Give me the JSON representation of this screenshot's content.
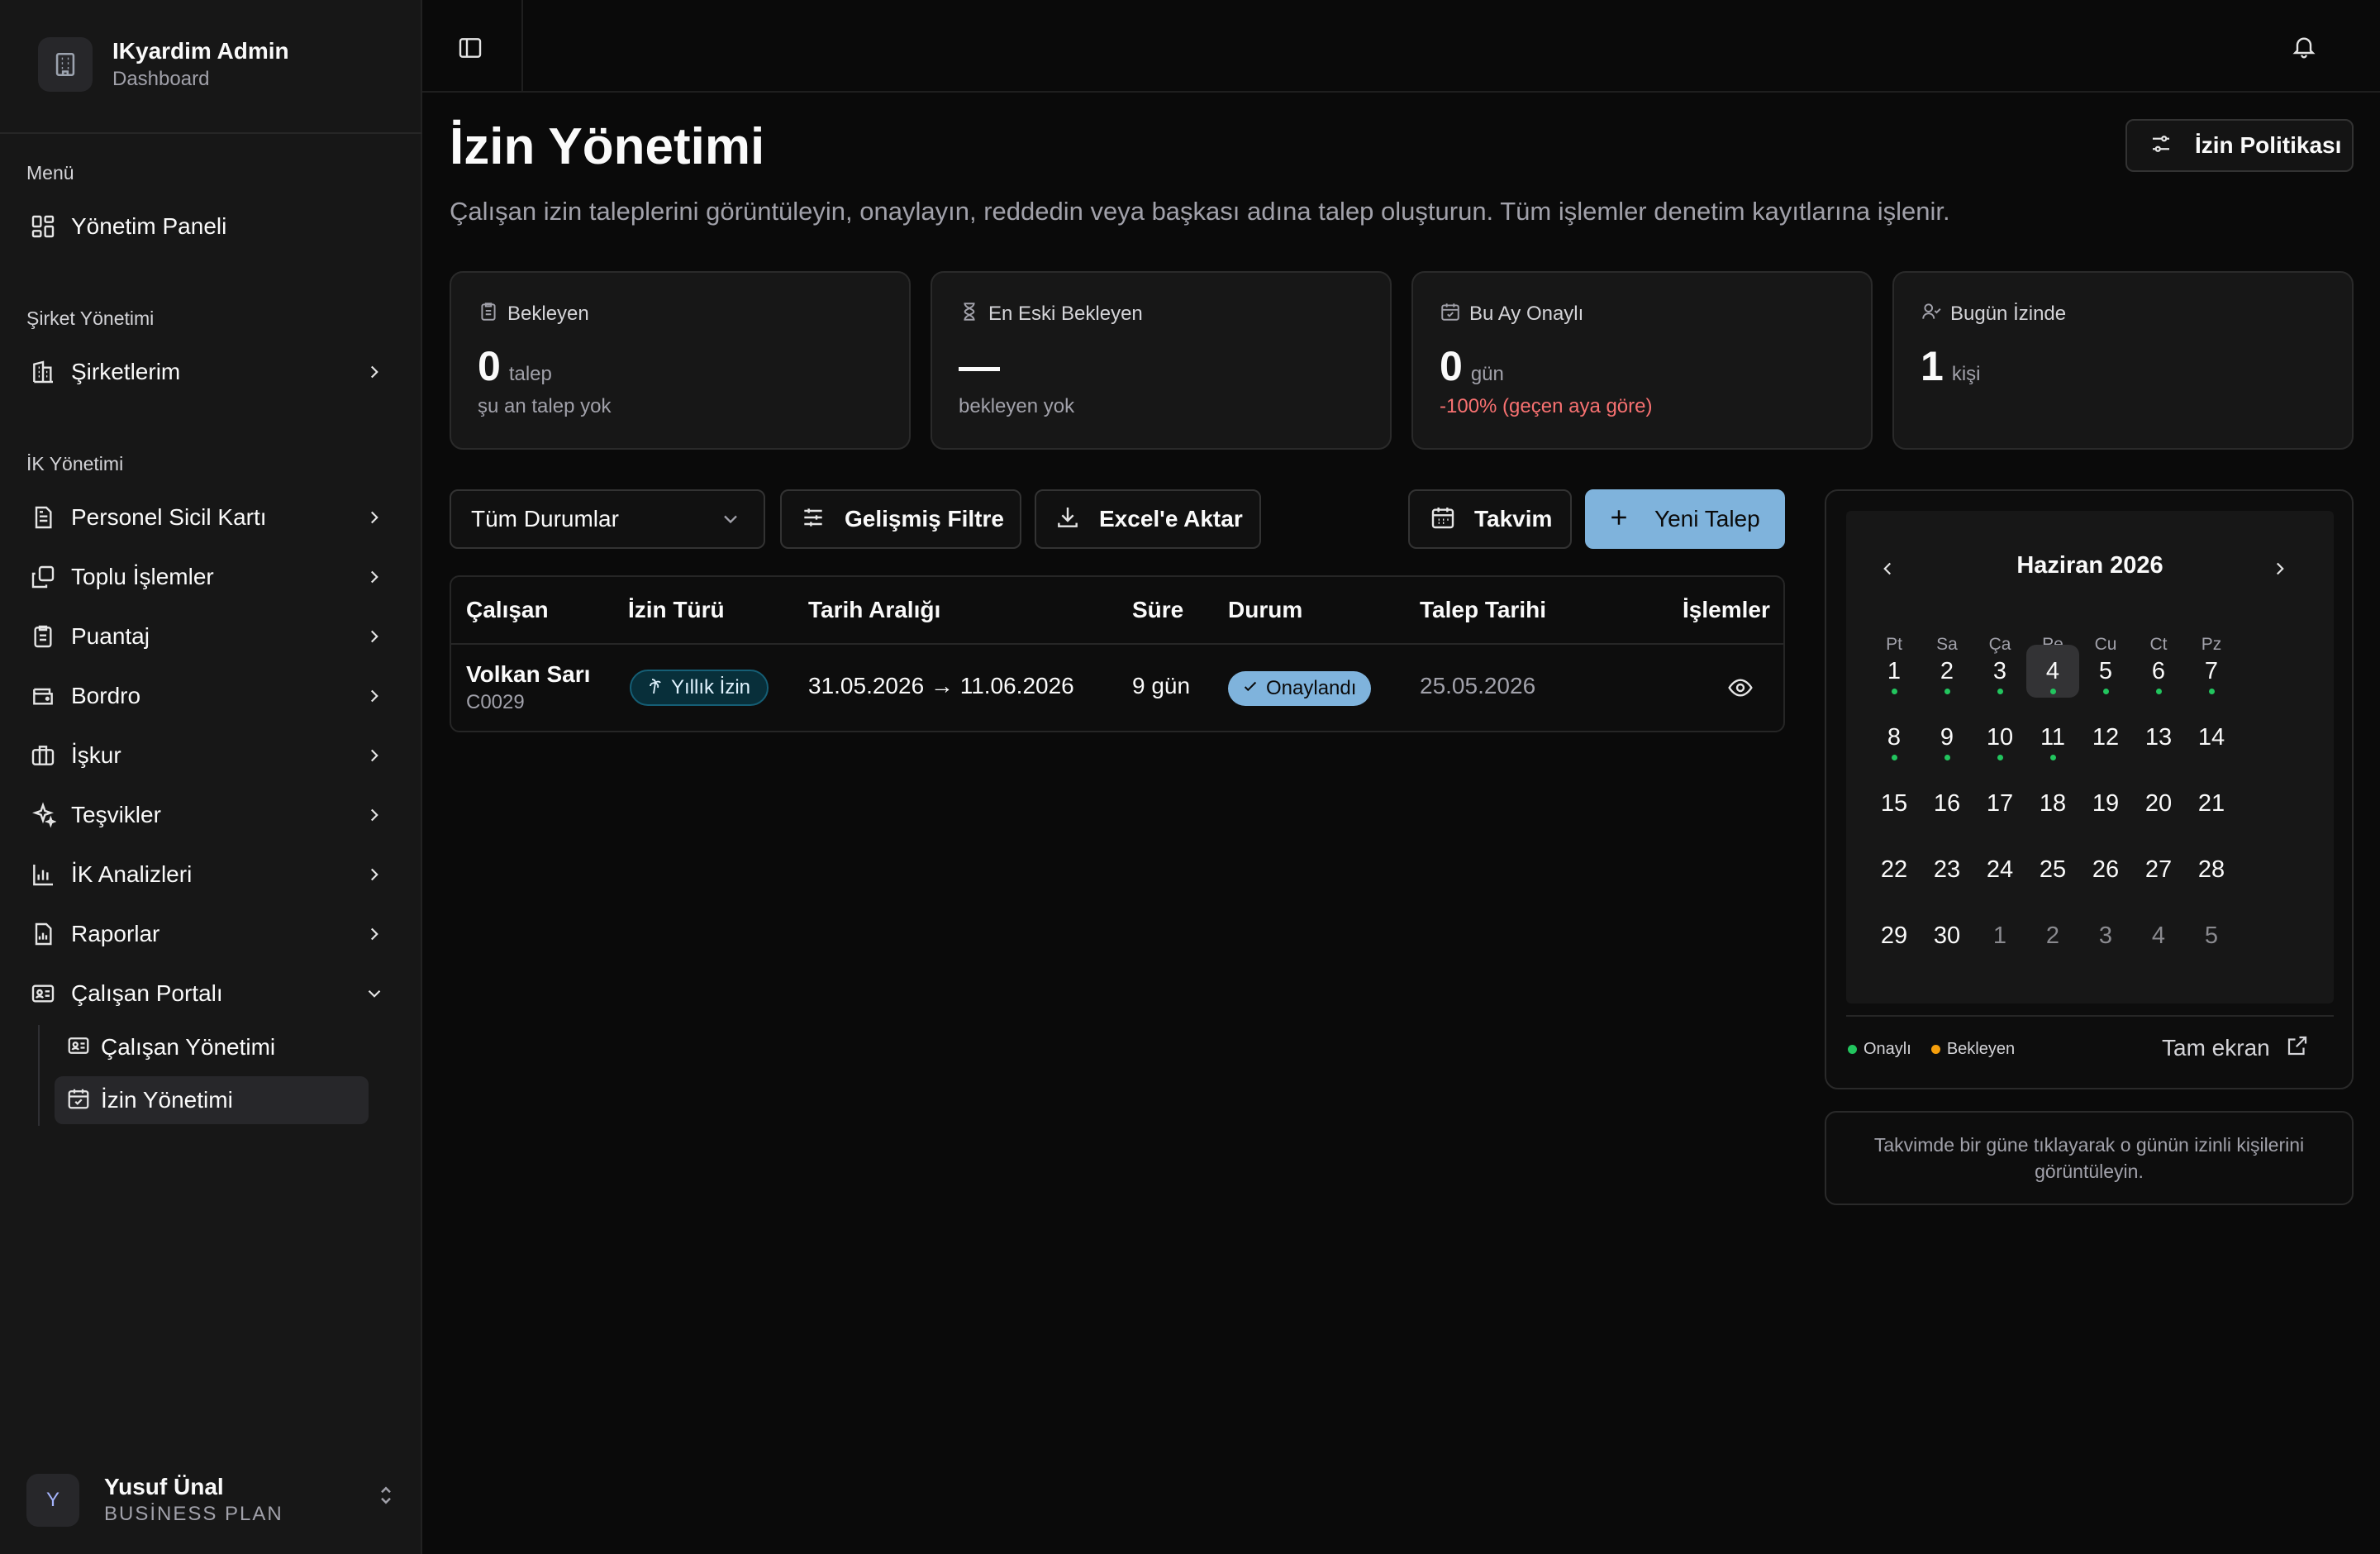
{
  "brand": {
    "title": "IKyardim Admin",
    "subtitle": "Dashboard"
  },
  "sidebar": {
    "menu_label": "Menü",
    "dashboard": "Yönetim Paneli",
    "company_label": "Şirket Yönetimi",
    "companies": "Şirketlerim",
    "hr_label": "İK Yönetimi",
    "items": [
      "Personel Sicil Kartı",
      "Toplu İşlemler",
      "Puantaj",
      "Bordro",
      "İşkur",
      "Teşvikler",
      "İK Analizleri",
      "Raporlar",
      "Çalışan Portalı"
    ],
    "subitems": [
      "Çalışan Yönetimi",
      "İzin Yönetimi"
    ],
    "user": {
      "name": "Yusuf Ünal",
      "plan": "BUSİNESS PLAN",
      "initial": "Y"
    }
  },
  "page": {
    "title": "İzin Yönetimi",
    "description": "Çalışan izin taleplerini görüntüleyin, onaylayın, reddedin veya başkası adına talep oluşturun. Tüm işlemler denetim kayıtlarına işlenir.",
    "policy_button": "İzin Politikası"
  },
  "stats": [
    {
      "label": "Bekleyen",
      "value": "0",
      "unit": "talep",
      "note": "şu an talep yok"
    },
    {
      "label": "En Eski Bekleyen",
      "value": "—",
      "unit": "",
      "note": "bekleyen yok"
    },
    {
      "label": "Bu Ay Onaylı",
      "value": "0",
      "unit": "gün",
      "note": "-100% (geçen aya göre)"
    },
    {
      "label": "Bugün İzinde",
      "value": "1",
      "unit": "kişi",
      "note": ""
    }
  ],
  "toolbar": {
    "status_select": "Tüm Durumlar",
    "filter": "Gelişmiş Filtre",
    "export": "Excel'e Aktar",
    "calendar": "Takvim",
    "new_request": "Yeni Talep"
  },
  "table": {
    "headers": [
      "Çalışan",
      "İzin Türü",
      "Tarih Aralığı",
      "Süre",
      "Durum",
      "Talep Tarihi",
      "İşlemler"
    ],
    "rows": [
      {
        "name": "Volkan Sarı",
        "code": "C0029",
        "type": "Yıllık İzin",
        "range": "31.05.2026 → 11.06.2026",
        "duration": "9 gün",
        "status": "Onaylandı",
        "request_date": "25.05.2026"
      }
    ]
  },
  "calendar": {
    "title": "Haziran 2026",
    "weekdays": [
      "Pt",
      "Sa",
      "Ça",
      "Pe",
      "Cu",
      "Ct",
      "Pz"
    ],
    "weeks": [
      [
        "1",
        "2",
        "3",
        "4",
        "5",
        "6",
        "7"
      ],
      [
        "8",
        "9",
        "10",
        "11",
        "12",
        "13",
        "14"
      ],
      [
        "15",
        "16",
        "17",
        "18",
        "19",
        "20",
        "21"
      ],
      [
        "22",
        "23",
        "24",
        "25",
        "26",
        "27",
        "28"
      ],
      [
        "29",
        "30",
        "1",
        "2",
        "3",
        "4",
        "5"
      ]
    ],
    "legend_approved": "Onaylı",
    "legend_pending": "Bekleyen",
    "fullscreen": "Tam ekran",
    "approved_color": "#22c55e",
    "pending_color": "#f59e0b",
    "hint": "Takvimde bir güne tıklayarak o günün izinli kişilerini görüntüleyin."
  }
}
